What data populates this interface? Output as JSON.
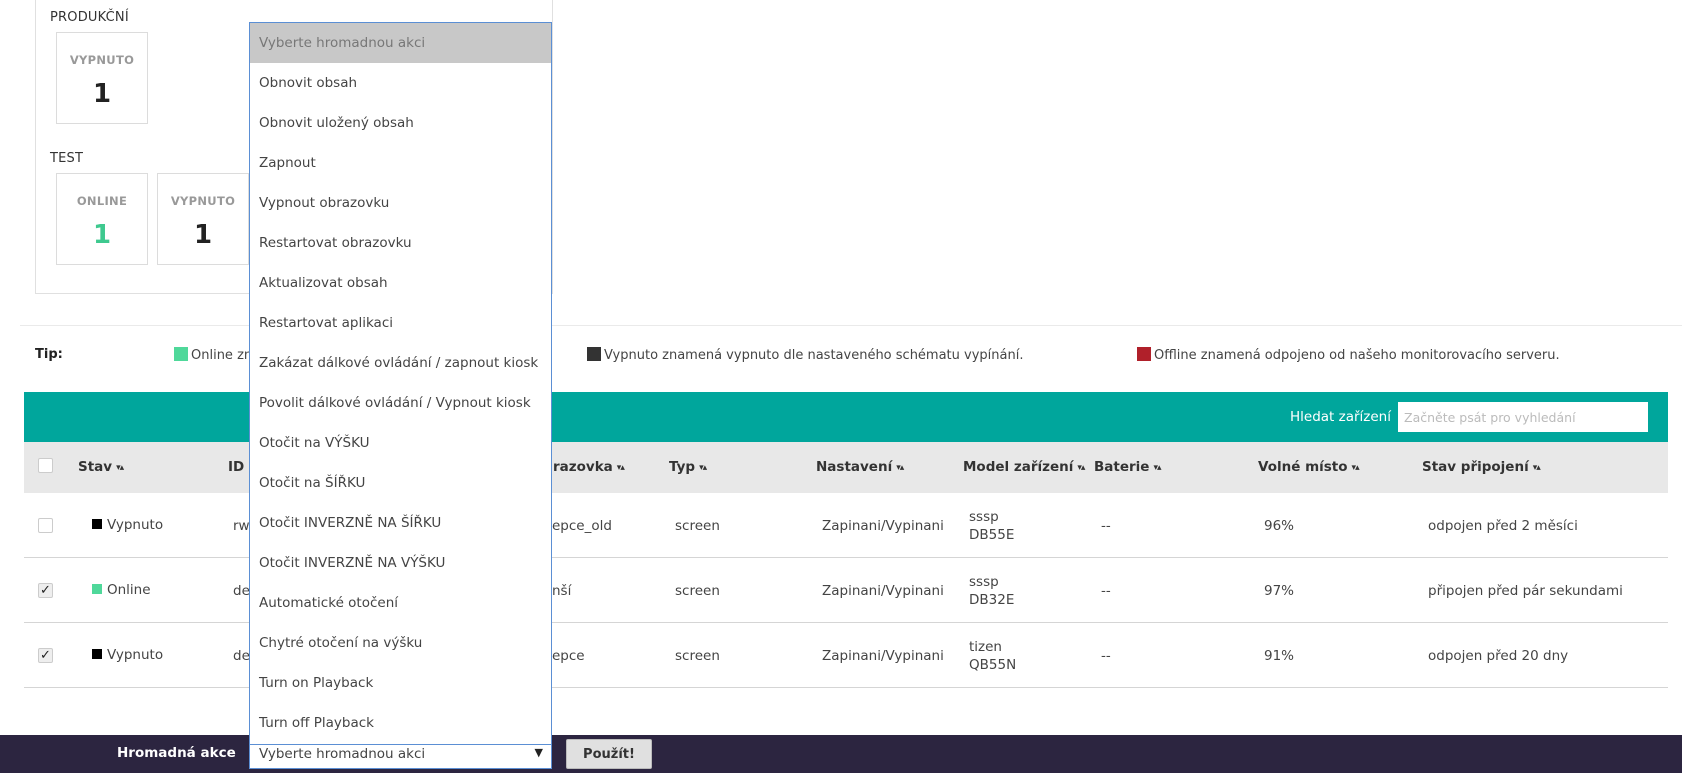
{
  "groups": [
    {
      "title": "PRODUKČNÍ",
      "stats": [
        {
          "label": "VYPNUTO",
          "value": "1"
        }
      ]
    },
    {
      "title": "TEST",
      "stats": [
        {
          "label": "ONLINE",
          "value": "1"
        },
        {
          "label": "VYPNUTO",
          "value": "1"
        }
      ]
    }
  ],
  "tip": {
    "label": "Tip:",
    "legend": [
      {
        "text": "Online zn",
        "color": "#4fd89a"
      },
      {
        "text": "Vypnuto znamená vypnuto dle nastaveného schématu vypínání.",
        "color": "#333333"
      },
      {
        "text": "Offline znamená odpojeno od našeho monitorovacího serveru.",
        "color": "#b0202a"
      }
    ]
  },
  "search": {
    "label": "Hledat zařízení",
    "placeholder": "Začněte psát pro vyhledání"
  },
  "table": {
    "headers": {
      "stav": "Stav",
      "id": "ID",
      "obrazovka": "razovka",
      "typ": "Typ",
      "nastaveni": "Nastavení",
      "model": "Model zařízení",
      "baterie": "Baterie",
      "volne_misto": "Volné místo",
      "stav_pripojeni": "Stav připojení"
    },
    "sort_icon": "▾▴",
    "rows": [
      {
        "checked": false,
        "checkmark": "",
        "status": "Vypnuto",
        "status_color": "#000000",
        "id": "rw",
        "obrazovka": "epce_old",
        "typ": "screen",
        "nastaveni": "Zapinani/Vypinani",
        "model_line1": "sssp",
        "model_line2": "DB55E",
        "baterie": "--",
        "volne_misto": "96%",
        "stav_pripojeni": "odpojen před 2 měsíci"
      },
      {
        "checked": true,
        "checkmark": "✓",
        "status": "Online",
        "status_color": "#4fd89a",
        "id": "de",
        "obrazovka": "nší",
        "typ": "screen",
        "nastaveni": "Zapinani/Vypinani",
        "model_line1": "sssp",
        "model_line2": "DB32E",
        "baterie": "--",
        "volne_misto": "97%",
        "stav_pripojeni": "připojen před pár sekundami"
      },
      {
        "checked": true,
        "checkmark": "✓",
        "status": "Vypnuto",
        "status_color": "#000000",
        "id": "de",
        "obrazovka": "epce",
        "typ": "screen",
        "nastaveni": "Zapinani/Vypinani",
        "model_line1": "tizen",
        "model_line2": "QB55N",
        "baterie": "--",
        "volne_misto": "91%",
        "stav_pripojeni": "odpojen před 20 dny"
      }
    ]
  },
  "bulk_action": {
    "label": "Hromadná akce",
    "selected": "Vyberte hromadnou akci",
    "arrow": "▼",
    "apply_label": "Použít!",
    "options": [
      "Vyberte hromadnou akci",
      "Obnovit obsah",
      "Obnovit uložený obsah",
      "Zapnout",
      "Vypnout obrazovku",
      "Restartovat obrazovku",
      "Aktualizovat obsah",
      "Restartovat aplikaci",
      "Zakázat dálkové ovládání / zapnout kiosk",
      "Povolit dálkové ovládání / Vypnout kiosk",
      "Otočit na VÝŠKU",
      "Otočit na ŠÍŘKU",
      "Otočit INVERZNĚ NA ŠÍŘKU",
      "Otočit INVERZNĚ NA VÝŠKU",
      "Automatické otočení",
      "Chytré otočení na výšku",
      "Turn on Playback",
      "Turn off Playback"
    ]
  }
}
